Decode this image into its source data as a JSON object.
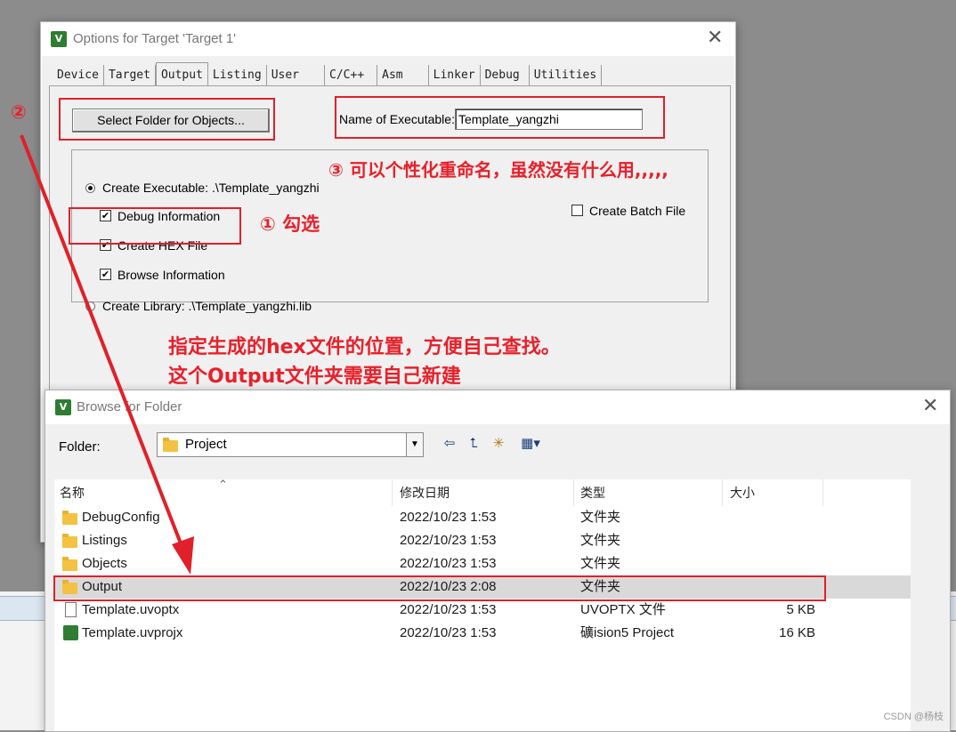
{
  "options_dialog": {
    "title": "Options for Target 'Target 1'",
    "close": "✕",
    "tabs": [
      "Device",
      "Target",
      "Output",
      "Listing",
      "User",
      "C/C++",
      "Asm",
      "Linker",
      "Debug",
      "Utilities"
    ],
    "active_tab": "Output",
    "select_folder_button": "Select Folder for Objects...",
    "name_of_executable_label": "Name of Executable:",
    "name_of_executable_value": "Template_yangzhi",
    "create_executable_label": "Create Executable:  .\\Template_yangzhi",
    "debug_information": "Debug Information",
    "create_hex_file": "Create HEX File",
    "browse_information": "Browse Information",
    "create_library_label": "Create Library:  .\\Template_yangzhi.lib",
    "create_batch_file": "Create Batch File",
    "checkmark": "✔"
  },
  "annotations": {
    "step1": "① 勾选",
    "step2": "②",
    "step3": "③ 可以个性化重命名，虽然没有什么用,,,,,",
    "note_line1": "指定生成的hex文件的位置，方便自己查找。",
    "note_line2": "这个Output文件夹需要自己新建",
    "color": "#e8202a"
  },
  "browse_dialog": {
    "title": "Browse for Folder",
    "close": "✕",
    "folder_label": "Folder:",
    "folder_value": "Project",
    "combo_arrow": "▼",
    "toolbar_icons": [
      "back-icon",
      "up-folder-icon",
      "new-folder-icon",
      "view-menu-icon"
    ],
    "toolbar_glyphs": [
      "⇦",
      "⮤",
      "✳",
      "▦▾"
    ],
    "columns": [
      "名称",
      "修改日期",
      "类型",
      "大小"
    ],
    "sort_glyph": "⌃",
    "rows": [
      {
        "name": "DebugConfig",
        "date": "2022/10/23 1:53",
        "type": "文件夹",
        "size": "",
        "icon": "folder-icon"
      },
      {
        "name": "Listings",
        "date": "2022/10/23 1:53",
        "type": "文件夹",
        "size": "",
        "icon": "folder-icon"
      },
      {
        "name": "Objects",
        "date": "2022/10/23 1:53",
        "type": "文件夹",
        "size": "",
        "icon": "folder-icon"
      },
      {
        "name": "Output",
        "date": "2022/10/23 2:08",
        "type": "文件夹",
        "size": "",
        "icon": "folder-icon"
      },
      {
        "name": "Template.uvoptx",
        "date": "2022/10/23 1:53",
        "type": "UVOPTX 文件",
        "size": "5 KB",
        "icon": "file-icon"
      },
      {
        "name": "Template.uvprojx",
        "date": "2022/10/23 1:53",
        "type": "礦ision5 Project",
        "size": "16 KB",
        "icon": "project-icon"
      }
    ],
    "selected_row": "Output"
  },
  "watermark": "CSDN @杨枝"
}
